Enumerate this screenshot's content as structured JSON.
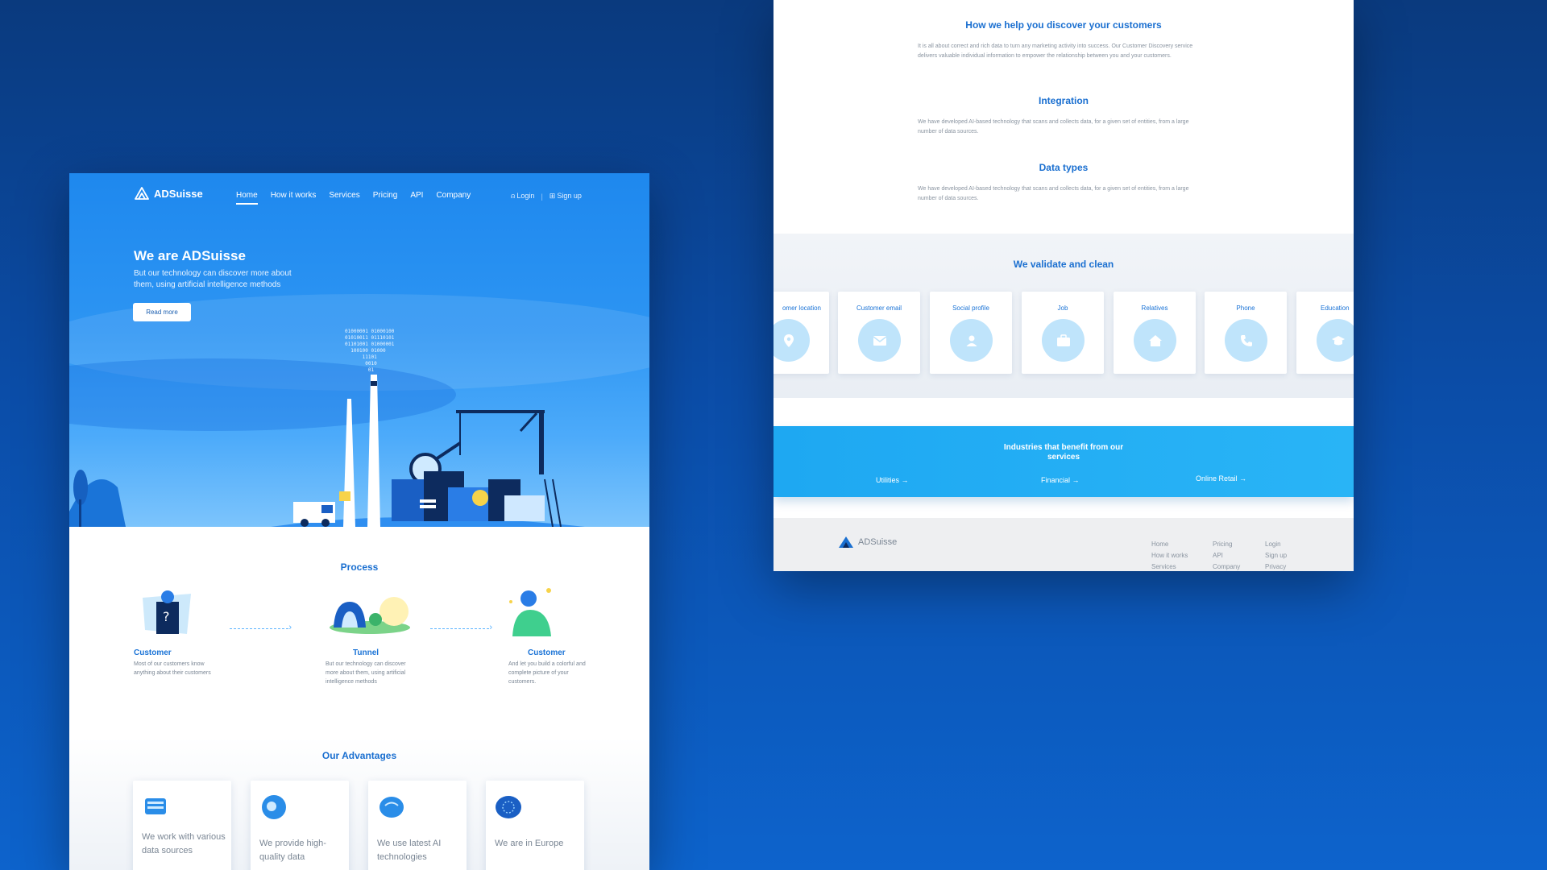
{
  "left": {
    "brand": "ADSuisse",
    "nav": [
      "Home",
      "How it works",
      "Services",
      "Pricing",
      "API",
      "Company"
    ],
    "login": "Login",
    "signup": "Sign up",
    "hero_title": "We are ADSuisse",
    "hero_sub": "But our technology can discover more about them, using artificial intelligence methods",
    "read_more": "Read more",
    "binary": "01000001 01000100\n01010011 01110101\n01101001 01000001\n  100100 01000\n      11101\n       0010\n        01",
    "process_title": "Process",
    "process": [
      {
        "title": "Customer",
        "desc": "Most of our customers know anything about their customers"
      },
      {
        "title": "Tunnel",
        "desc": "But our technology can discover more about them, using artificial intelligence methods"
      },
      {
        "title": "Customer",
        "desc": "And let you build a colorful and complete picture of your customers."
      }
    ],
    "advantages_title": "Our Advantages",
    "advantages": [
      "We work with various data sources",
      "We provide high-quality data",
      "We use latest AI technologies",
      "We are in Europe"
    ]
  },
  "right": {
    "sections": [
      {
        "title": "How we help you discover your customers",
        "text": "It is all about correct and rich data to turn any marketing activity into success. Our Customer Discovery service delivers valuable individual information to empower the relationship between you and your customers."
      },
      {
        "title": "Integration",
        "text": "We have developed AI-based technology that scans and collects data, for a given set of entities, from a large number of data sources."
      },
      {
        "title": "Data types",
        "text": "We have developed AI-based technology that scans and collects data, for a given set of entities, from a large number of data sources."
      }
    ],
    "validate_title": "We validate and clean",
    "validate_cards": [
      {
        "label": "omer location",
        "icon": "location-pin-icon"
      },
      {
        "label": "Customer email",
        "icon": "envelope-icon"
      },
      {
        "label": "Social profile",
        "icon": "user-icon"
      },
      {
        "label": "Job",
        "icon": "briefcase-icon"
      },
      {
        "label": "Relatives",
        "icon": "home-icon"
      },
      {
        "label": "Phone",
        "icon": "phone-icon"
      },
      {
        "label": "Education",
        "icon": "graduation-cap-icon"
      }
    ],
    "industries_title": "Industries that benefit from our services",
    "industries": [
      "Utilities →",
      "Financial →",
      "Online Retail →"
    ],
    "footer_brand": "ADSuisse",
    "footer_cols": [
      [
        "Home",
        "How it works",
        "Services"
      ],
      [
        "Pricing",
        "API",
        "Company"
      ],
      [
        "Login",
        "Sign up",
        "Privacy"
      ]
    ]
  },
  "colors": {
    "background_dark": "#0a3a7e",
    "background_light": "#0d63cc",
    "hero_blue": "#2d95f3",
    "accent_text": "#1a6fd0",
    "industries_band": "#29b4f6",
    "icon_circle": "#bfe4fb"
  }
}
